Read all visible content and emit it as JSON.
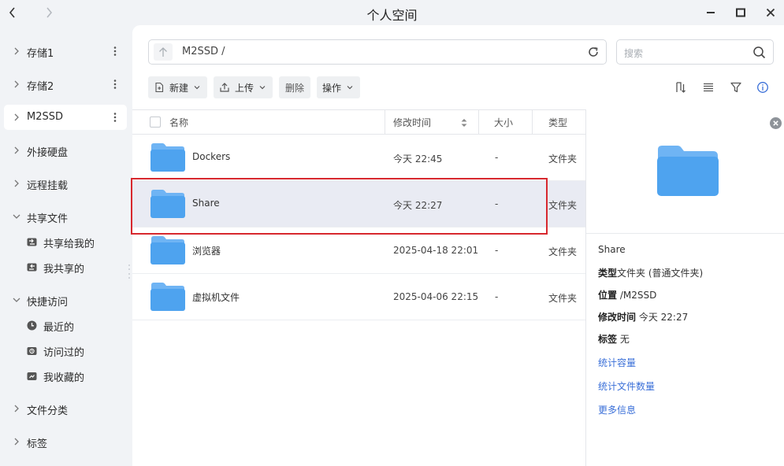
{
  "window": {
    "title": "个人空间"
  },
  "sidebar": {
    "items": [
      {
        "label": "存储1"
      },
      {
        "label": "存储2"
      },
      {
        "label": "M2SSD"
      },
      {
        "label": "外接硬盘"
      },
      {
        "label": "远程挂载"
      },
      {
        "label": "共享文件"
      },
      {
        "label": "快捷访问"
      },
      {
        "label": "文件分类"
      },
      {
        "label": "标签"
      }
    ],
    "share_children": [
      {
        "label": "共享给我的",
        "icon": "share-in-icon"
      },
      {
        "label": "我共享的",
        "icon": "share-out-icon"
      }
    ],
    "quick_children": [
      {
        "label": "最近的",
        "icon": "clock-icon"
      },
      {
        "label": "访问过的",
        "icon": "history-folder-icon"
      },
      {
        "label": "我收藏的",
        "icon": "favorite-folder-icon"
      }
    ],
    "selected": "M2SSD"
  },
  "pathbar": {
    "path": "M2SSD /"
  },
  "search": {
    "placeholder": "搜索"
  },
  "toolbar": {
    "new_label": "新建",
    "upload_label": "上传",
    "delete_label": "删除",
    "ops_label": "操作"
  },
  "table": {
    "headers": {
      "name": "名称",
      "mtime": "修改时间",
      "size": "大小",
      "type": "类型"
    },
    "rows": [
      {
        "name": "Dockers",
        "mtime": "今天 22:45",
        "size": "-",
        "type": "文件夹"
      },
      {
        "name": "Share",
        "mtime": "今天 22:27",
        "size": "-",
        "type": "文件夹"
      },
      {
        "name": "浏览器",
        "mtime": "2025-04-18 22:01",
        "size": "-",
        "type": "文件夹"
      },
      {
        "name": "虚拟机文件",
        "mtime": "2025-04-06 22:15",
        "size": "-",
        "type": "文件夹"
      }
    ],
    "selected_row": "Share"
  },
  "details": {
    "name": "Share",
    "type_label": "类型",
    "type_value": "文件夹 (普通文件夹)",
    "location_label": "位置",
    "location_value": " /M2SSD",
    "mtime_label": "修改时间",
    "mtime_value": " 今天 22:27",
    "tag_label": "标签",
    "tag_value": " 无",
    "links": {
      "capacity": "统计容量",
      "count": "统计文件数量",
      "more": "更多信息"
    }
  },
  "colors": {
    "accent": "#3a6fd8",
    "folder": "#5aa8f0",
    "selection_outline": "#d7282e",
    "row_highlight": "#e9ebf3"
  }
}
